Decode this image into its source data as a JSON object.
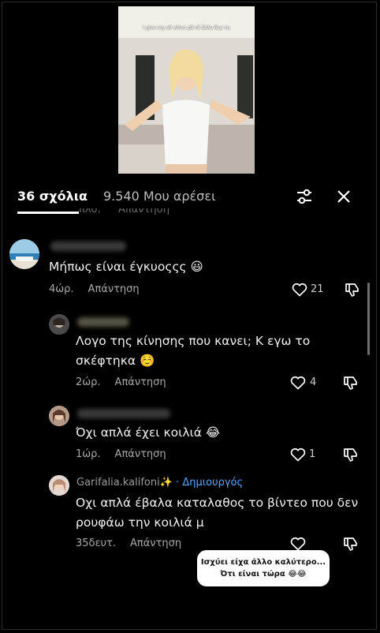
{
  "video": {
    "caption": "I give my all when på rå åλλο θεγ τα"
  },
  "header": {
    "comments_tab": "36 σχόλια",
    "likes_tab": "9.540 Μου αρέσει",
    "filter_icon": "filter-sliders-icon",
    "close_icon": "close-icon"
  },
  "cut_row": {
    "time": "πλσ.",
    "reply": "Απάντηση"
  },
  "comments": [
    {
      "text": "Μήπως είναι έγκυοςςς 😃",
      "time": "4ώρ.",
      "reply": "Απάντηση",
      "likes": "21"
    },
    {
      "text_line1": "Λογο της κίνησης που κανει; Κ εγω το",
      "text_line2": "σκέφτηκα ☺️",
      "time": "2ώρ.",
      "reply": "Απάντηση",
      "likes": "4"
    },
    {
      "text": "Όχι απλά έχει κοιλιά 😂",
      "time": "1ώρ.",
      "reply": "Απάντηση",
      "likes": "1"
    },
    {
      "username": "Garifalia.kalifoni✨",
      "badge": " · Δημιουργός",
      "text_line1": "Οχι απλά έβαλα καταλαθος το βίντεο που δεν",
      "text_line2": "ρουφάω την κοιλιά μ",
      "time": "35δευτ.",
      "reply": "Απάντηση",
      "likes": ""
    }
  ],
  "sticker": {
    "line1": "Ισχύει είχα άλλο καλύτερο...",
    "line2": "Ότι είναι τώρα 😂😂"
  },
  "colors": {
    "background": "#000000",
    "creator_badge": "#4fa6ff",
    "meta_text": "#a8a8a8"
  }
}
